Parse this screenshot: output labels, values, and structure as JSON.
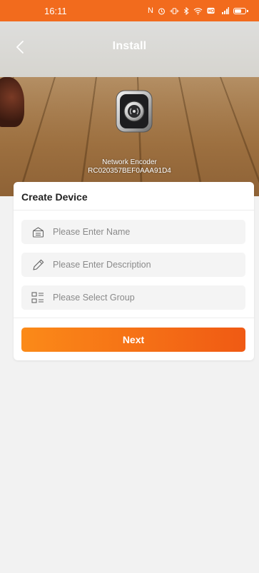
{
  "status_bar": {
    "time": "16:11",
    "icons": [
      "nfc-icon",
      "alarm-icon",
      "vibrate-icon",
      "bluetooth-icon",
      "wifi-icon",
      "hd-icon",
      "signal-icon",
      "battery-icon"
    ]
  },
  "header": {
    "title": "Install"
  },
  "device": {
    "name": "Network Encoder",
    "serial": "RC020357BEF0AAA91D4"
  },
  "form": {
    "title": "Create Device",
    "name_placeholder": "Please Enter Name",
    "description_placeholder": "Please Enter Description",
    "group_label": "Please Select Group",
    "next_label": "Next"
  },
  "colors": {
    "accent": "#f26b1d",
    "button_start": "#fb8a18",
    "button_end": "#f05a14"
  }
}
